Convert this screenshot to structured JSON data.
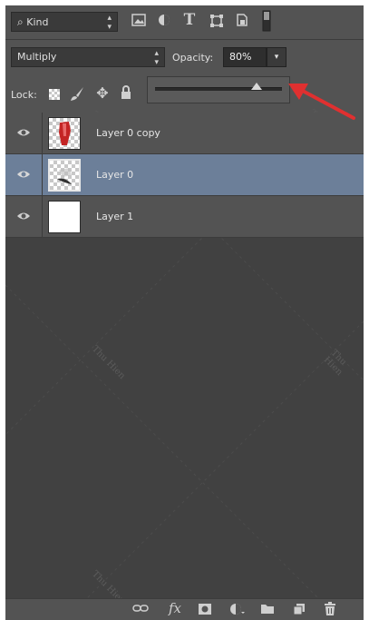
{
  "filter": {
    "kind_label": "Kind"
  },
  "blend": {
    "mode": "Multiply",
    "opacity_label": "Opacity:",
    "opacity_value": "80%",
    "opacity_fraction": 0.8
  },
  "lock": {
    "label": "Lock:"
  },
  "layers": [
    {
      "name": "Layer 0 copy",
      "selected": false
    },
    {
      "name": "Layer 0",
      "selected": true
    },
    {
      "name": "Layer 1",
      "selected": false
    }
  ],
  "bottom_bar": {
    "fx_label": "fx"
  },
  "watermark": "Thu Hien",
  "colors": {
    "panel": "#535353",
    "selection": "#6c7f99",
    "arrow": "#e03030"
  }
}
